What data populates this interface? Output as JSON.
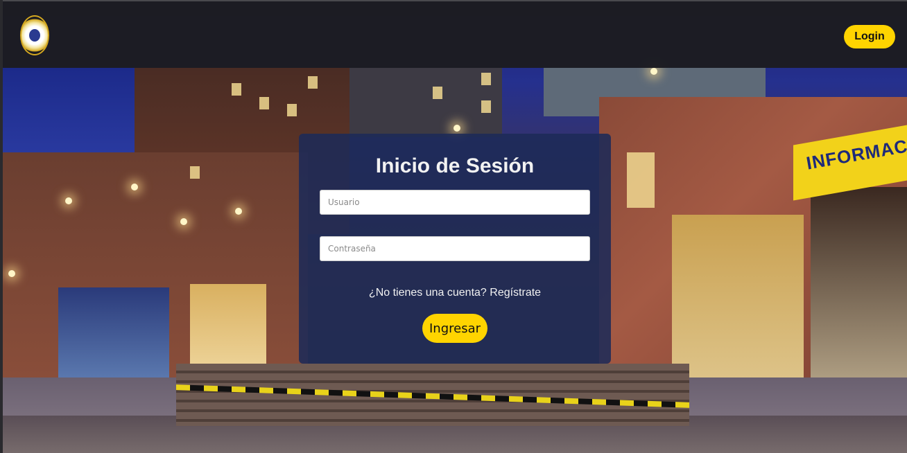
{
  "navbar": {
    "logo_icon": "university-seal-icon",
    "login_label": "Login"
  },
  "background": {
    "sign_text": "INFORMAC",
    "accent_color": "#ffd400",
    "card_color": "#1c2a58"
  },
  "login_form": {
    "title": "Inicio de Sesión",
    "username_placeholder": "Usuario",
    "password_placeholder": "Contraseña",
    "register_link": "¿No tienes una cuenta? Regístrate",
    "submit_label": "Ingresar"
  }
}
